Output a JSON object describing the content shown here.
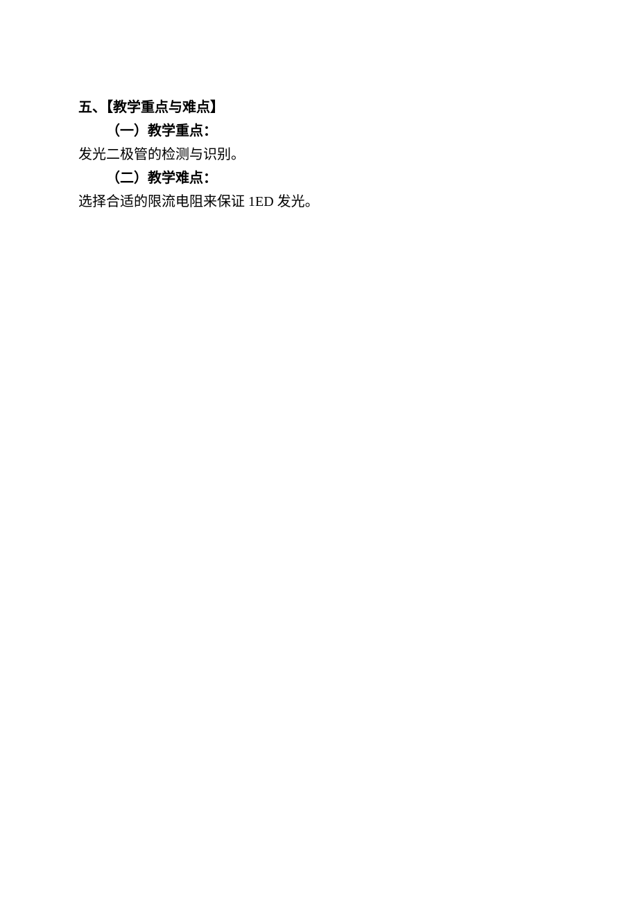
{
  "section": {
    "title": "五、【教学重点与难点】",
    "sub1": {
      "heading": "（一）教学重点：",
      "content": "发光二极管的检测与识别。"
    },
    "sub2": {
      "heading": "（二）教学难点：",
      "content": "选择合适的限流电阻来保证 1ED 发光。"
    }
  }
}
